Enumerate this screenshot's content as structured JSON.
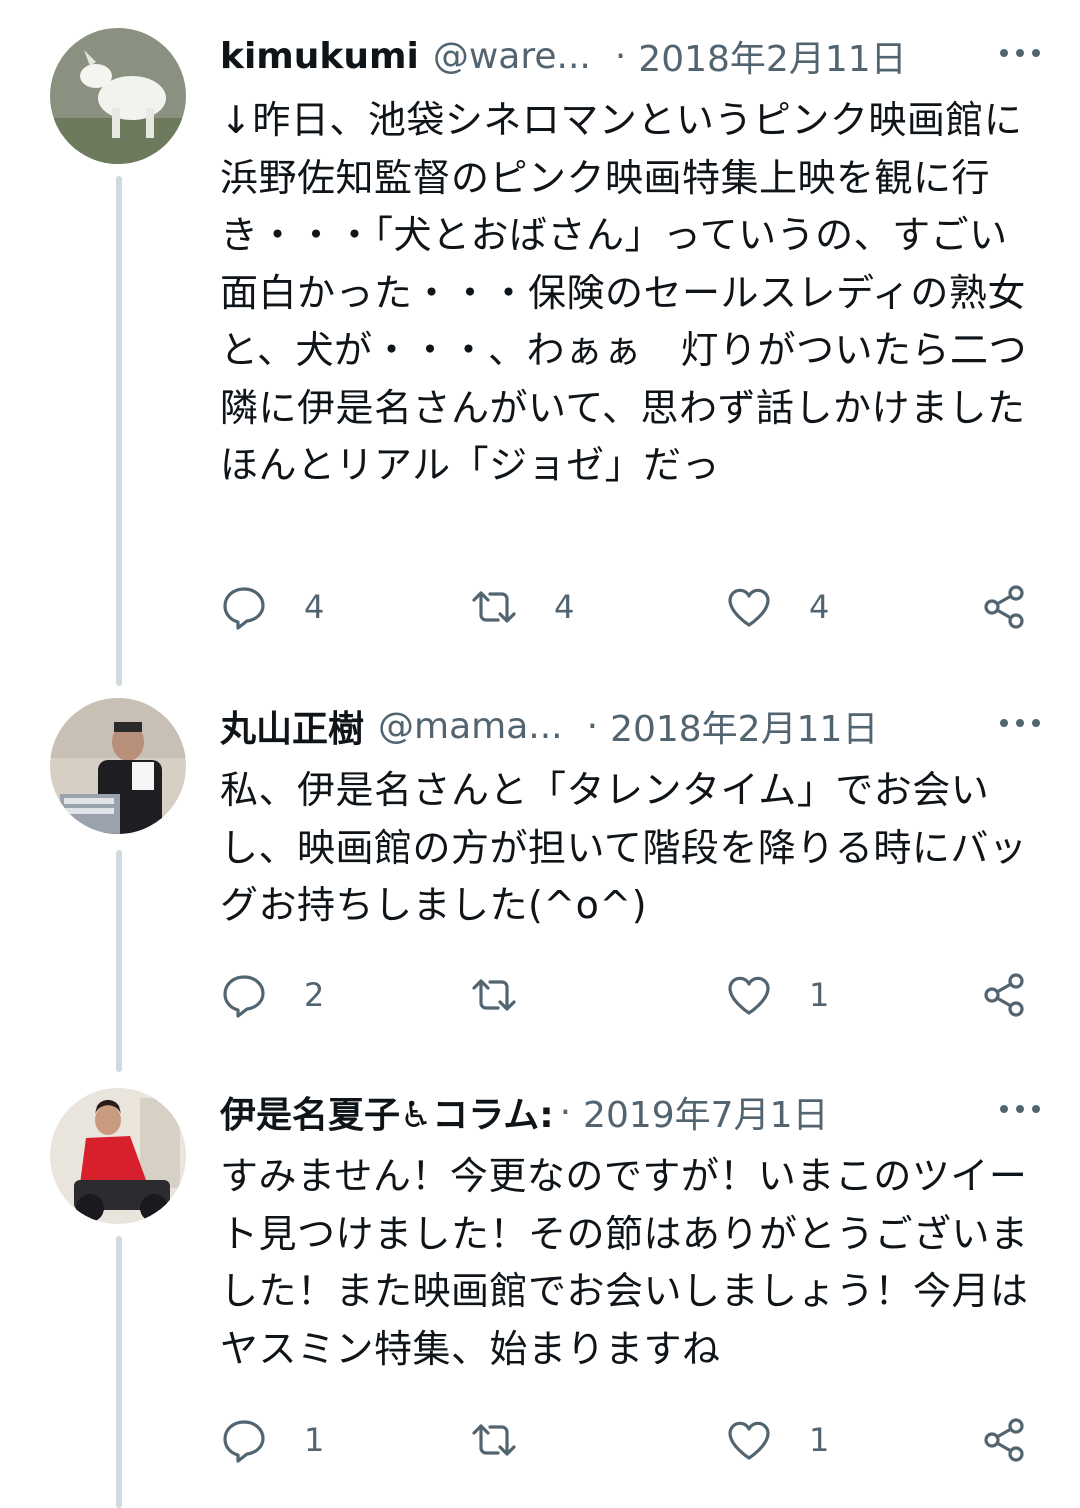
{
  "tweets": [
    {
      "name": "kimukumi",
      "handle": "@ware...",
      "separator": "·",
      "date": "2018年2月11日",
      "text": "↓昨日、池袋シネロマンというピンク映画館に浜野佐知監督のピンク映画特集上映を観に行き・・・「犬とおばさん」っていうの、すごい面白かった・・・保険のセールスレディの熟女と、犬が・・・、わぁぁ　灯りがついたら二つ隣に伊是名さんがいて、思わず話しかけました　ほんとリアル「ジョゼ」だっ",
      "replies": "4",
      "retweets": "4",
      "likes": "4"
    },
    {
      "name": "丸山正樹",
      "handle": "@mama...",
      "separator": "·",
      "date": "2018年2月11日",
      "text": "私、伊是名さんと「タレンタイム」でお会いし、映画館の方が担いて階段を降りる時にバッグお持ちしました(^o^)",
      "replies": "2",
      "retweets": "",
      "likes": "1"
    },
    {
      "name": "伊是名夏子♿コラム:",
      "handle": "",
      "separator": "·",
      "date": "2019年7月1日",
      "text": "すみません！今更なのですが！いまこのツイート見つけました！その節はありがとうございました！また映画館でお会いしましょう！今月はヤスミン特集、始まりますね",
      "replies": "1",
      "retweets": "",
      "likes": "1"
    }
  ],
  "icons": {
    "reply": "reply-icon",
    "retweet": "retweet-icon",
    "like": "heart-icon",
    "share": "share-icon",
    "more": "more-icon"
  },
  "colors": {
    "text": "#0f1419",
    "secondary": "#536471",
    "thread_line": "#cfd9de"
  }
}
